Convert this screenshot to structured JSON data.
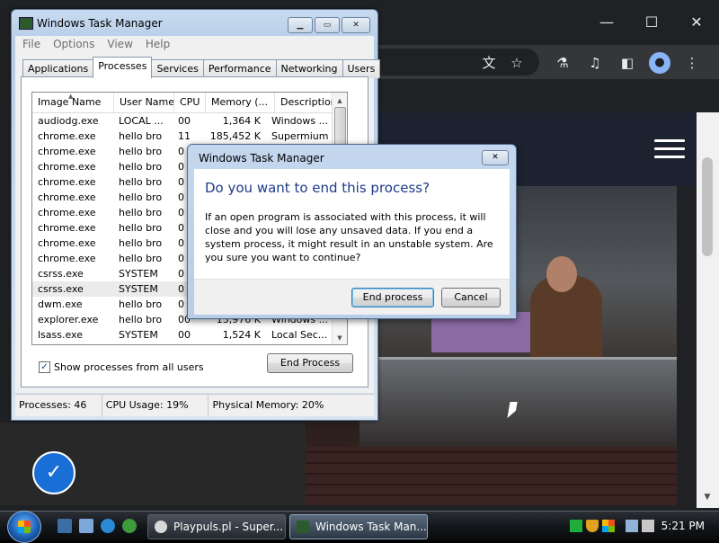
{
  "colors": {
    "dialog_heading": "#1e3b8a",
    "chrome_bg": "#202124",
    "accessibility_blue": "#1a6fd6"
  },
  "browser": {
    "window_controls": [
      "—",
      "☐",
      "✕"
    ],
    "toolbar_icons": [
      "translate-icon",
      "star-icon",
      "flask-icon",
      "media-queue-icon",
      "side-panel-icon",
      "profile-icon",
      "more-icon"
    ]
  },
  "task_manager": {
    "title": "Windows Task Manager",
    "menu": [
      "File",
      "Options",
      "View",
      "Help"
    ],
    "tabs": [
      "Applications",
      "Processes",
      "Services",
      "Performance",
      "Networking",
      "Users"
    ],
    "active_tab": "Processes",
    "columns": [
      "Image Name",
      "User Name",
      "CPU",
      "Memory (...",
      "Description"
    ],
    "processes": [
      {
        "image": "audiodg.exe",
        "user": "LOCAL ...",
        "cpu": "00",
        "memory": "1,364 K",
        "description": "Windows ..."
      },
      {
        "image": "chrome.exe",
        "user": "hello bro",
        "cpu": "11",
        "memory": "185,452 K",
        "description": "Supermium"
      },
      {
        "image": "chrome.exe",
        "user": "hello bro",
        "cpu": "0",
        "memory": "",
        "description": ""
      },
      {
        "image": "chrome.exe",
        "user": "hello bro",
        "cpu": "0",
        "memory": "",
        "description": ""
      },
      {
        "image": "chrome.exe",
        "user": "hello bro",
        "cpu": "0",
        "memory": "",
        "description": ""
      },
      {
        "image": "chrome.exe",
        "user": "hello bro",
        "cpu": "0",
        "memory": "",
        "description": ""
      },
      {
        "image": "chrome.exe",
        "user": "hello bro",
        "cpu": "0",
        "memory": "",
        "description": ""
      },
      {
        "image": "chrome.exe",
        "user": "hello bro",
        "cpu": "0",
        "memory": "",
        "description": ""
      },
      {
        "image": "chrome.exe",
        "user": "hello bro",
        "cpu": "0",
        "memory": "",
        "description": ""
      },
      {
        "image": "chrome.exe",
        "user": "hello bro",
        "cpu": "0",
        "memory": "",
        "description": ""
      },
      {
        "image": "csrss.exe",
        "user": "SYSTEM",
        "cpu": "0",
        "memory": "",
        "description": ""
      },
      {
        "image": "csrss.exe",
        "user": "SYSTEM",
        "cpu": "0",
        "memory": "",
        "description": ""
      },
      {
        "image": "dwm.exe",
        "user": "hello bro",
        "cpu": "0",
        "memory": "",
        "description": ""
      },
      {
        "image": "explorer.exe",
        "user": "hello bro",
        "cpu": "00",
        "memory": "13,976 K",
        "description": "Windows ..."
      },
      {
        "image": "lsass.exe",
        "user": "SYSTEM",
        "cpu": "00",
        "memory": "1,524 K",
        "description": "Local Sec..."
      }
    ],
    "selected_row": 11,
    "show_all_label": "Show processes from all users",
    "show_all_checked": true,
    "end_process_label": "End Process",
    "status": {
      "processes": "Processes: 46",
      "cpu": "CPU Usage: 19%",
      "memory": "Physical Memory: 20%"
    }
  },
  "dialog": {
    "title": "Windows Task Manager",
    "heading": "Do you want to end this process?",
    "message": "If an open program is associated with this process, it will close and you will lose any unsaved data. If you end a system process, it might result in an unstable system. Are you sure you want to continue?",
    "confirm_label": "End process",
    "cancel_label": "Cancel"
  },
  "taskbar": {
    "tasks": [
      {
        "label": "Playpuls.pl - Super...",
        "icon": "supermium-icon"
      },
      {
        "label": "Windows Task Man...",
        "icon": "task-manager-icon"
      }
    ],
    "clock": "5:21 PM"
  }
}
